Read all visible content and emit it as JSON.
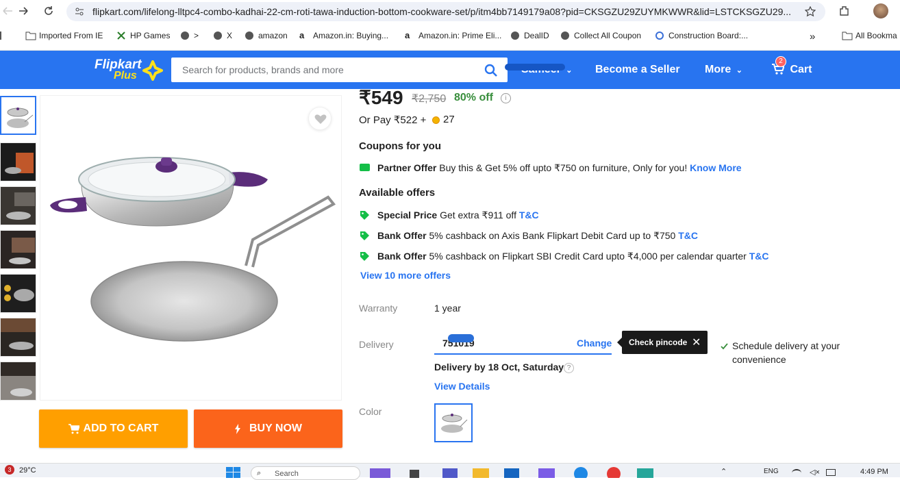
{
  "browser": {
    "url": "flipkart.com/lifelong-lltpc4-combo-kadhai-22-cm-roti-tawa-induction-bottom-cookware-set/p/itm4bb7149179a08?pid=CKSGZU29ZUYMKWWR&lid=LSTCKSGZU29...",
    "bookmarks": [
      "Imported From IE",
      "HP Games",
      ">",
      "X",
      "amazon",
      "Amazon.in: Buying...",
      "Amazon.in: Prime Eli...",
      "DealID",
      "Collect All Coupon",
      "Construction Board:..."
    ],
    "bookmarks_overflow": "»",
    "all_bookmarks": "All Bookma"
  },
  "header": {
    "logo_top": "Flipkart",
    "logo_bottom": "Plus",
    "search_placeholder": "Search for products, brands and more",
    "user": "Sameer",
    "become_seller": "Become a Seller",
    "more": "More",
    "cart": "Cart",
    "cart_count": "2"
  },
  "product": {
    "price": "₹549",
    "mrp": "₹2,750",
    "discount": "80% off",
    "or_pay": "Or Pay ₹522 +",
    "coins": "27",
    "coupons_heading": "Coupons for you",
    "coupon": {
      "title": "Partner Offer",
      "text": "Buy this & Get 5% off upto ₹750 on furniture, Only for you!",
      "link": "Know More"
    },
    "offers_heading": "Available offers",
    "offers": [
      {
        "title": "Special Price",
        "text": "Get extra ₹911 off",
        "link": "T&C"
      },
      {
        "title": "Bank Offer",
        "text": "5% cashback on Axis Bank Flipkart Debit Card up to ₹750",
        "link": "T&C"
      },
      {
        "title": "Bank Offer",
        "text": "5% cashback on Flipkart SBI Credit Card upto ₹4,000 per calendar quarter",
        "link": "T&C"
      }
    ],
    "view_more_offers": "View 10 more offers",
    "warranty_label": "Warranty",
    "warranty_value": "1 year",
    "delivery_label": "Delivery",
    "pincode": "751019",
    "change": "Change",
    "tooltip": "Check pincode",
    "delivery_by": "Delivery by 18 Oct, Saturday",
    "help": "?",
    "view_details": "View Details",
    "schedule_line1": "Schedule delivery at your",
    "schedule_line2": "convenience",
    "color_label": "Color",
    "add_to_cart": "ADD TO CART",
    "buy_now": "BUY NOW"
  },
  "taskbar": {
    "weather_badge": "3",
    "temperature": "29°C",
    "search": "Search",
    "lang": "ENG",
    "time": "4:49 PM"
  },
  "colors": {
    "flipkart_blue": "#2874f0",
    "add_to_cart": "#ff9f00",
    "buy_now": "#fb641b",
    "discount_green": "#388e3c",
    "offer_tag_green": "#14be47"
  }
}
